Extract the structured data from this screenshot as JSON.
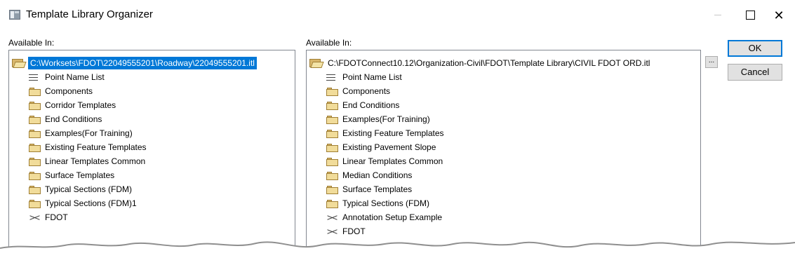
{
  "window": {
    "title": "Template Library Organizer",
    "minimize_glyph": "—",
    "close_glyph": "✕"
  },
  "left_panel": {
    "label": "Available In:",
    "root": "C:\\Worksets\\FDOT\\22049555201\\Roadway\\22049555201.itl",
    "items": [
      {
        "label": "Point Name List",
        "icon": "list-icon"
      },
      {
        "label": "Components",
        "icon": "folder-icon"
      },
      {
        "label": "Corridor Templates",
        "icon": "folder-icon"
      },
      {
        "label": "End Conditions",
        "icon": "folder-icon"
      },
      {
        "label": "Examples(For Training)",
        "icon": "folder-icon"
      },
      {
        "label": "Existing Feature Templates",
        "icon": "folder-icon"
      },
      {
        "label": "Linear Templates Common",
        "icon": "folder-icon"
      },
      {
        "label": "Surface Templates",
        "icon": "folder-icon"
      },
      {
        "label": "Typical Sections (FDM)",
        "icon": "folder-icon"
      },
      {
        "label": "Typical Sections (FDM)1",
        "icon": "folder-icon"
      },
      {
        "label": "FDOT",
        "icon": "template-icon"
      }
    ]
  },
  "right_panel": {
    "label": "Available In:",
    "root": "C:\\FDOTConnect10.12\\Organization-Civil\\FDOT\\Template Library\\CIVIL FDOT ORD.itl",
    "browse_label": "...",
    "items": [
      {
        "label": "Point Name List",
        "icon": "list-icon"
      },
      {
        "label": "Components",
        "icon": "folder-icon"
      },
      {
        "label": "End Conditions",
        "icon": "folder-icon"
      },
      {
        "label": "Examples(For Training)",
        "icon": "folder-icon"
      },
      {
        "label": "Existing Feature Templates",
        "icon": "folder-icon"
      },
      {
        "label": "Existing Pavement Slope",
        "icon": "folder-icon"
      },
      {
        "label": "Linear Templates Common",
        "icon": "folder-icon"
      },
      {
        "label": "Median Conditions",
        "icon": "folder-icon"
      },
      {
        "label": "Surface Templates",
        "icon": "folder-icon"
      },
      {
        "label": "Typical Sections (FDM)",
        "icon": "folder-icon"
      },
      {
        "label": "Annotation Setup Example",
        "icon": "template-icon"
      },
      {
        "label": "FDOT",
        "icon": "template-icon"
      }
    ]
  },
  "buttons": {
    "ok": "OK",
    "cancel": "Cancel"
  }
}
